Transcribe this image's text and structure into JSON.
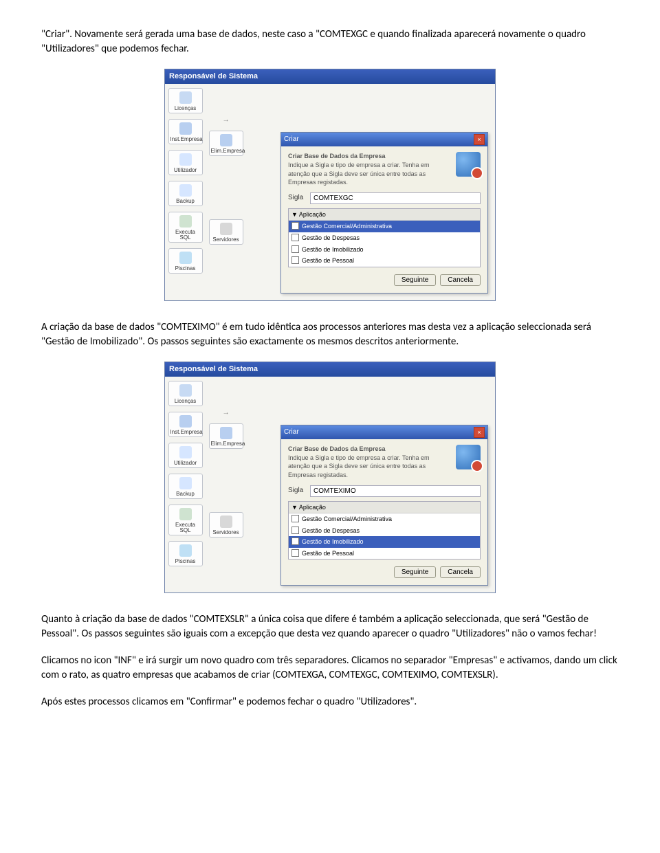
{
  "paragraphs": {
    "p1": "\"Criar\". Novamente será gerada uma base de dados, neste caso a \"COMTEXGC e quando finalizada aparecerá novamente o quadro \"Utilizadores\" que podemos fechar.",
    "p2": "A criação da base de dados \"COMTEXIMO\" é em tudo idêntica aos processos anteriores mas desta vez a aplicação seleccionada será \"Gestão de Imobilizado\". Os passos seguintes são exactamente os mesmos descritos anteriormente.",
    "p3": "Quanto à criação da base de dados \"COMTEXSLR\" a única coisa que difere é também a aplicação seleccionada, que será \"Gestão de Pessoal\". Os passos seguintes são iguais com a excepção que desta vez quando aparecer o quadro \"Utilizadores\" não o vamos fechar!",
    "p4": "Clicamos no icon \"INF\" e irá surgir um novo quadro com três separadores. Clicamos no separador \"Empresas\" e activamos, dando um click com o rato, as quatro empresas que acabamos de criar (COMTEXGA, COMTEXGC, COMTEXIMO, COMTEXSLR).",
    "p5": "Após estes processos clicamos em \"Confirmar\" e podemos fechar o quadro \"Utilizadores\"."
  },
  "app": {
    "title": "Responsável de Sistema",
    "sidebar": [
      "Licenças",
      "Inst.Empresa",
      "Elim.Empresa",
      "Utilizador",
      "Backup",
      "Executa SQL",
      "Servidores",
      "Piscinas"
    ],
    "dialog": {
      "title": "Criar",
      "heading": "Criar Base de Dados da Empresa",
      "desc": "Indique a Sigla e tipo de empresa a criar. Tenha em atenção que a Sigla deve ser única entre todas as Empresas registadas.",
      "sigla_label": "Sigla",
      "list_header": "▼ Aplicação",
      "apps": [
        "Gestão Comercial/Administrativa",
        "Gestão de Despesas",
        "Gestão de Imobilizado",
        "Gestão de Pessoal"
      ],
      "btn_next": "Seguinte",
      "btn_cancel": "Cancela"
    }
  },
  "shots": {
    "s1": {
      "sigla": "COMTEXGC",
      "selected": 0
    },
    "s2": {
      "sigla": "COMTEXIMO",
      "selected": 2
    }
  }
}
